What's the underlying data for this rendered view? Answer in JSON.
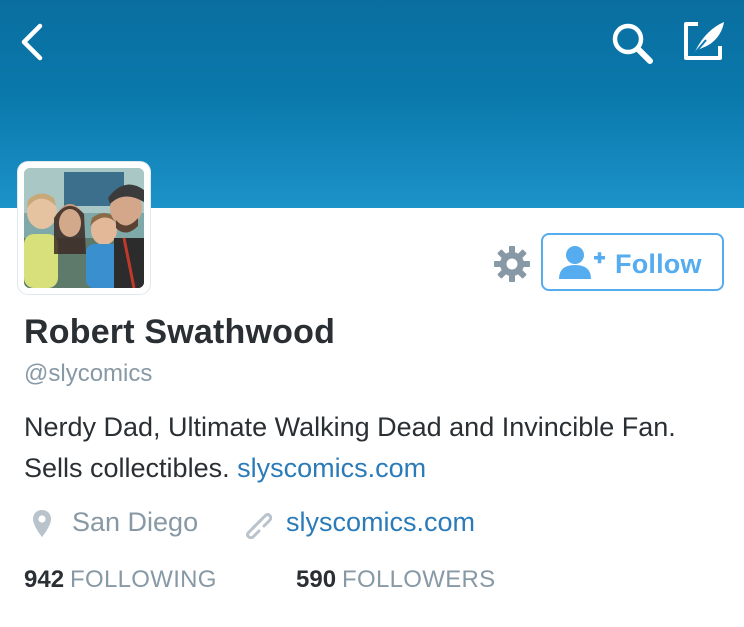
{
  "header": {
    "back_icon": "chevron-left-icon",
    "search_icon": "search-icon",
    "compose_icon": "compose-tweet-icon",
    "banner_color": "#0a78ab"
  },
  "profile": {
    "avatar_alt": "profile photo",
    "name": "Robert Swathwood",
    "handle": "@slycomics",
    "bio_text": "Nerdy Dad, Ultimate Walking Dead and Invincible Fan. Sells collectibles. ",
    "bio_link": "slyscomics.com",
    "location": "San Diego",
    "website": "slyscomics.com"
  },
  "actions": {
    "settings_icon": "gear-icon",
    "follow_icon": "add-user-icon",
    "follow_label": "Follow",
    "accent_color": "#55acee"
  },
  "stats": {
    "following_count": "942",
    "following_label": "FOLLOWING",
    "followers_count": "590",
    "followers_label": "FOLLOWERS"
  }
}
